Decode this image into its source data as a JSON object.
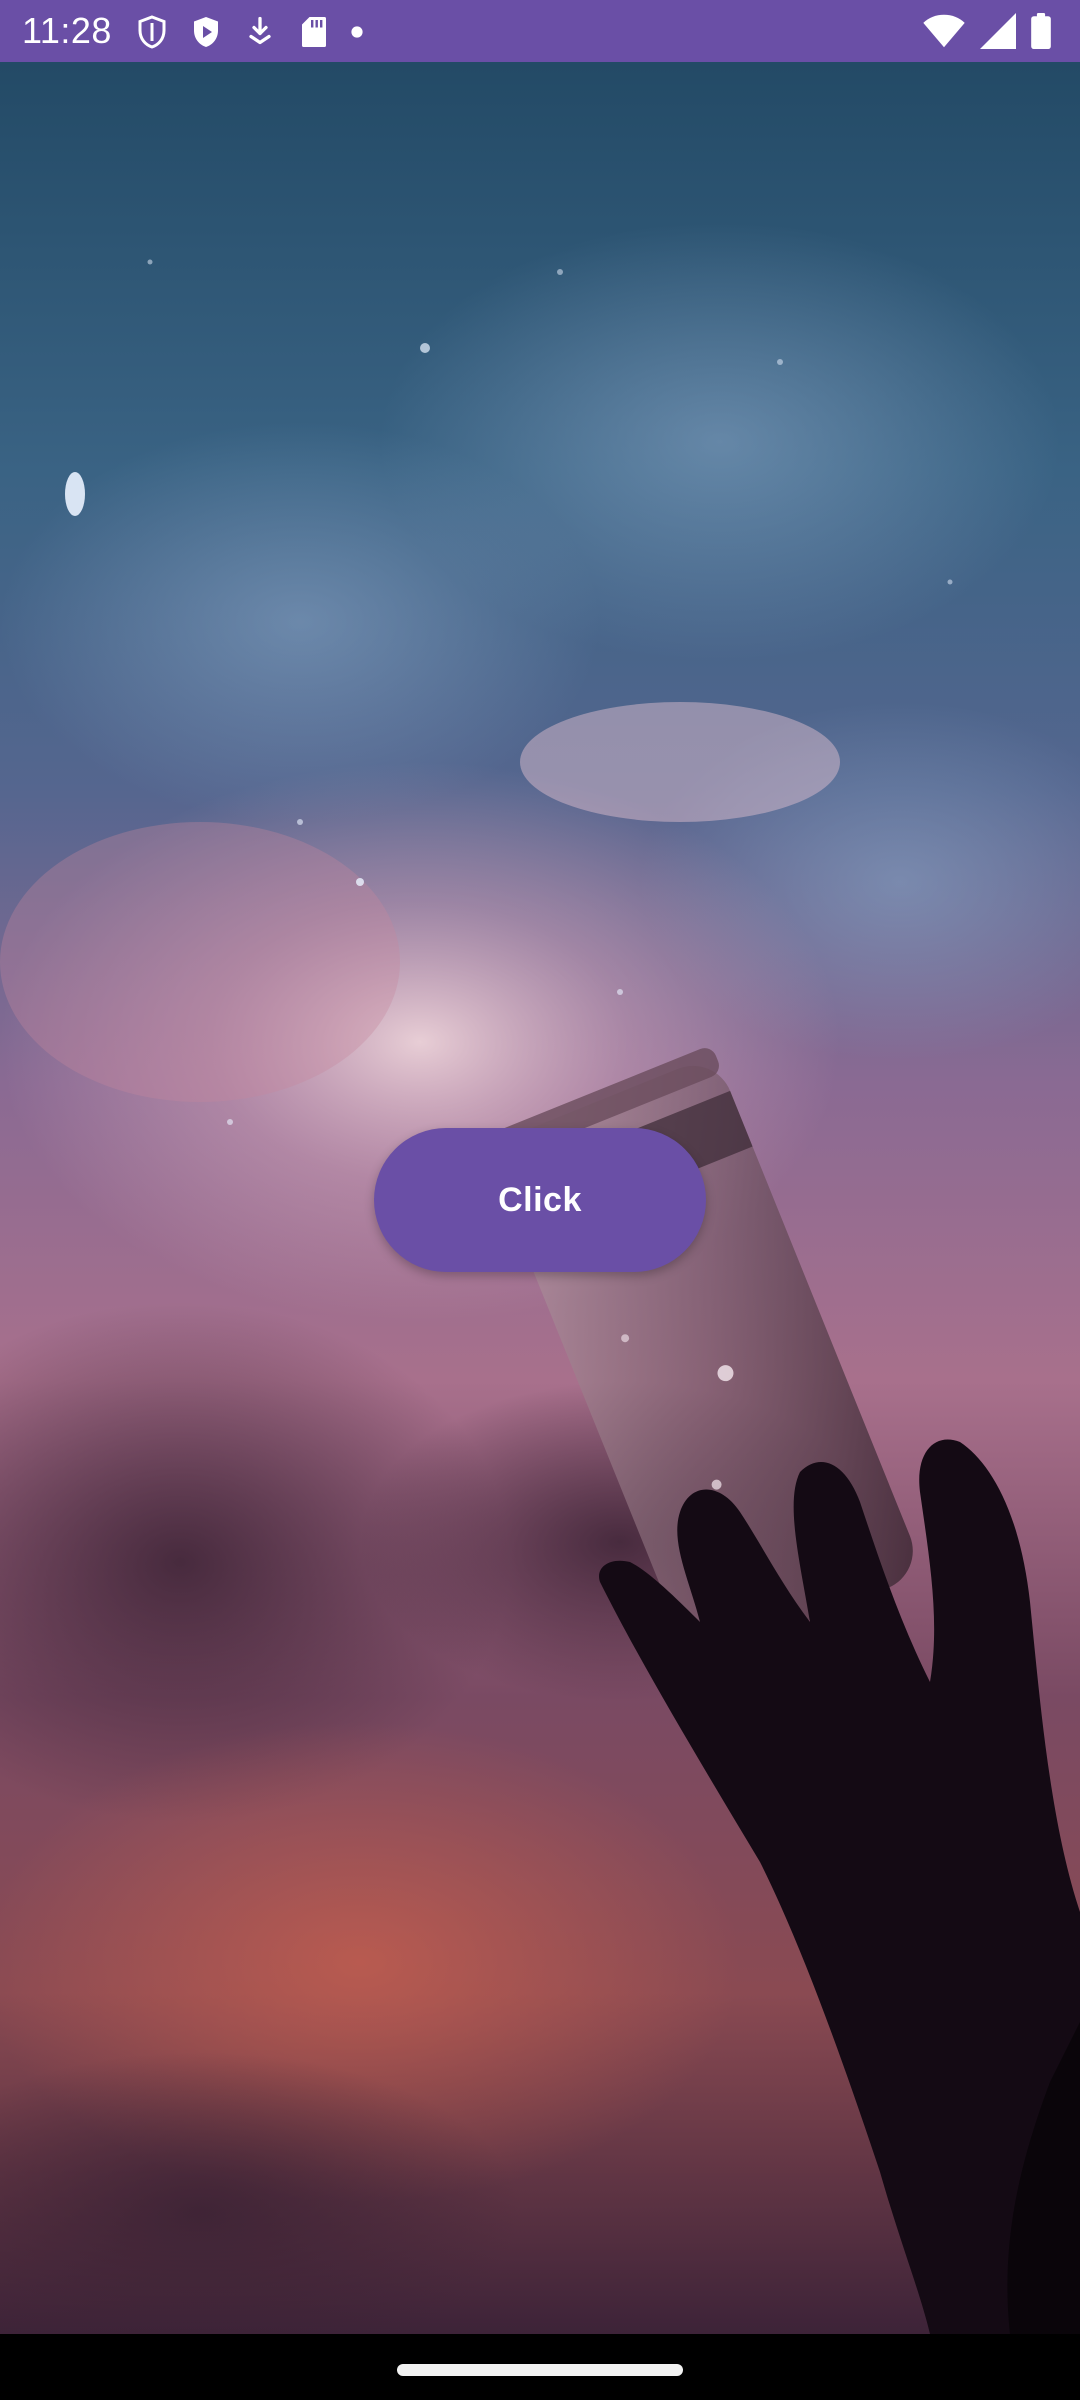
{
  "status_bar": {
    "time": "11:28",
    "background_color": "#6a4fa6",
    "left_icons": [
      "shield-icon",
      "play-store-icon",
      "download-icon",
      "sd-card-icon",
      "notification-dot-icon"
    ],
    "right_icons": [
      "wifi-icon",
      "signal-icon",
      "battery-icon"
    ]
  },
  "main": {
    "wallpaper": "night-sky-jar-hand-image",
    "button": {
      "label": "Click",
      "color": "#6a4fa6"
    }
  },
  "nav_bar": {
    "handle": "home-gesture-handle"
  }
}
